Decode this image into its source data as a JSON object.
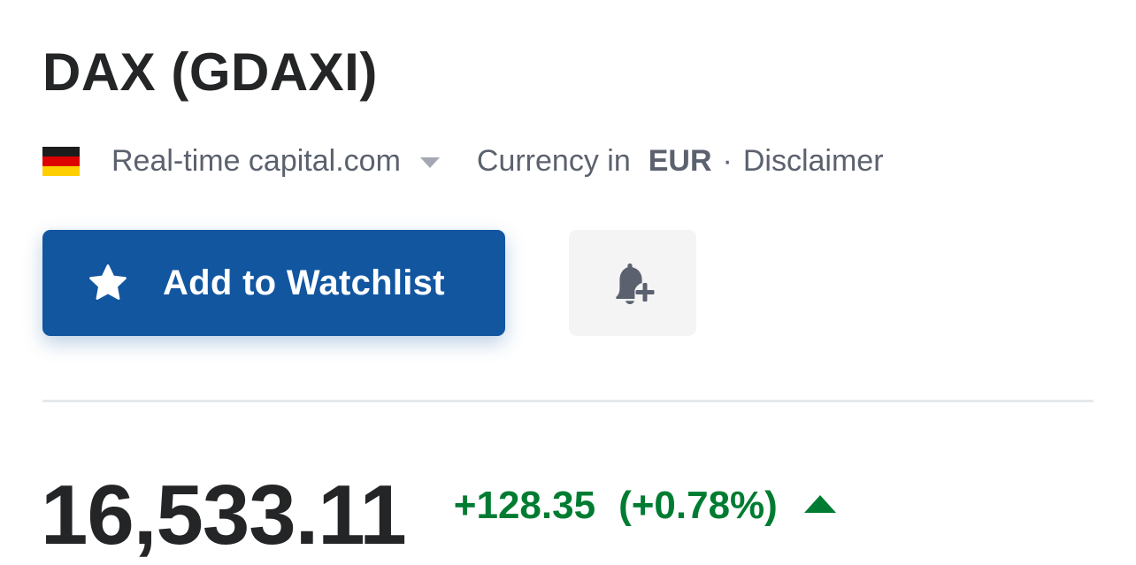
{
  "header": {
    "title": "DAX (GDAXI)"
  },
  "meta": {
    "flag_icon": "germany-flag-icon",
    "flag_colors": [
      "#1c1c1c",
      "#dd0000",
      "#ffce00"
    ],
    "source_label": "Real-time capital.com",
    "currency_prefix": "Currency in",
    "currency_code": "EUR",
    "separator": "·",
    "disclaimer_label": "Disclaimer"
  },
  "actions": {
    "watchlist_label": "Add to Watchlist",
    "watchlist_icon": "star-icon",
    "alert_icon": "bell-plus-icon",
    "accent_color": "#1256a0"
  },
  "quote": {
    "price": "16,533.11",
    "change": "+128.35",
    "change_percent": "(+0.78%)",
    "direction": "up",
    "positive_color": "#007c32"
  }
}
